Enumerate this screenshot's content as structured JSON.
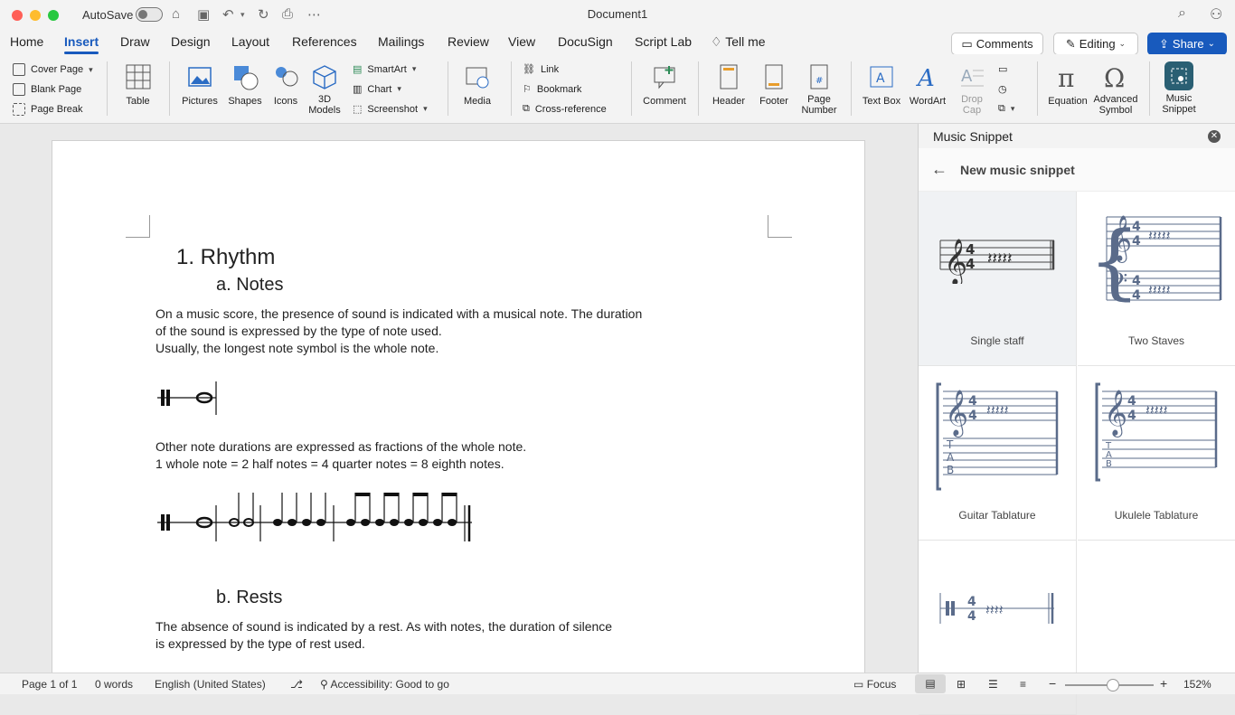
{
  "window": {
    "title": "Document1",
    "autosave_label": "AutoSave",
    "traffic": {
      "close": "#ff5f57",
      "minimize": "#febc2e",
      "maximize": "#28c840"
    }
  },
  "tabs": [
    "Home",
    "Insert",
    "Draw",
    "Design",
    "Layout",
    "References",
    "Mailings",
    "Review",
    "View",
    "DocuSign",
    "Script Lab"
  ],
  "tell_me": "Tell me",
  "actions": {
    "comments": "Comments",
    "editing": "Editing",
    "share": "Share"
  },
  "ribbon": {
    "pages": {
      "cover_page": "Cover Page",
      "blank_page": "Blank Page",
      "page_break": "Page Break"
    },
    "table": "Table",
    "pictures": "Pictures",
    "shapes": "Shapes",
    "icons": "Icons",
    "models_3d_line1": "3D",
    "models_3d_line2": "Models",
    "smartart": "SmartArt",
    "chart": "Chart",
    "screenshot": "Screenshot",
    "media": "Media",
    "link": "Link",
    "bookmark": "Bookmark",
    "cross_reference": "Cross-reference",
    "comment": "Comment",
    "header": "Header",
    "footer": "Footer",
    "page_number_line1": "Page",
    "page_number_line2": "Number",
    "text_box": "Text Box",
    "wordart": "WordArt",
    "drop_cap_line1": "Drop",
    "drop_cap_line2": "Cap",
    "equation": "Equation",
    "advanced_symbol_line1": "Advanced",
    "advanced_symbol_line2": "Symbol",
    "music_snippet_line1": "Music",
    "music_snippet_line2": "Snippet"
  },
  "document": {
    "heading1": "1. Rhythm",
    "heading_a": "a. Notes",
    "para1": "On a music score, the presence of sound is indicated with a musical note. The duration\nof the sound is expressed by the type of note used.\nUsually, the longest note symbol is the whole note.",
    "para2": "Other note durations are expressed as fractions of the whole note.\n1 whole note = 2 half notes = 4 quarter notes = 8 eighth notes.",
    "heading_b": "b. Rests",
    "para3": "The absence of sound is indicated by a rest. As with notes, the duration of silence\nis expressed by the type of rest used."
  },
  "panel": {
    "title": "Music Snippet",
    "subtitle": "New music snippet",
    "templates": [
      "Single staff",
      "Two Staves",
      "Guitar Tablature",
      "Ukulele Tablature"
    ]
  },
  "status": {
    "page": "Page 1 of 1",
    "words": "0 words",
    "language": "English (United States)",
    "accessibility": "Accessibility: Good to go",
    "focus": "Focus",
    "zoom": "152%"
  },
  "colors": {
    "accent": "#185abd",
    "music_blue": "#5a6b8a"
  }
}
